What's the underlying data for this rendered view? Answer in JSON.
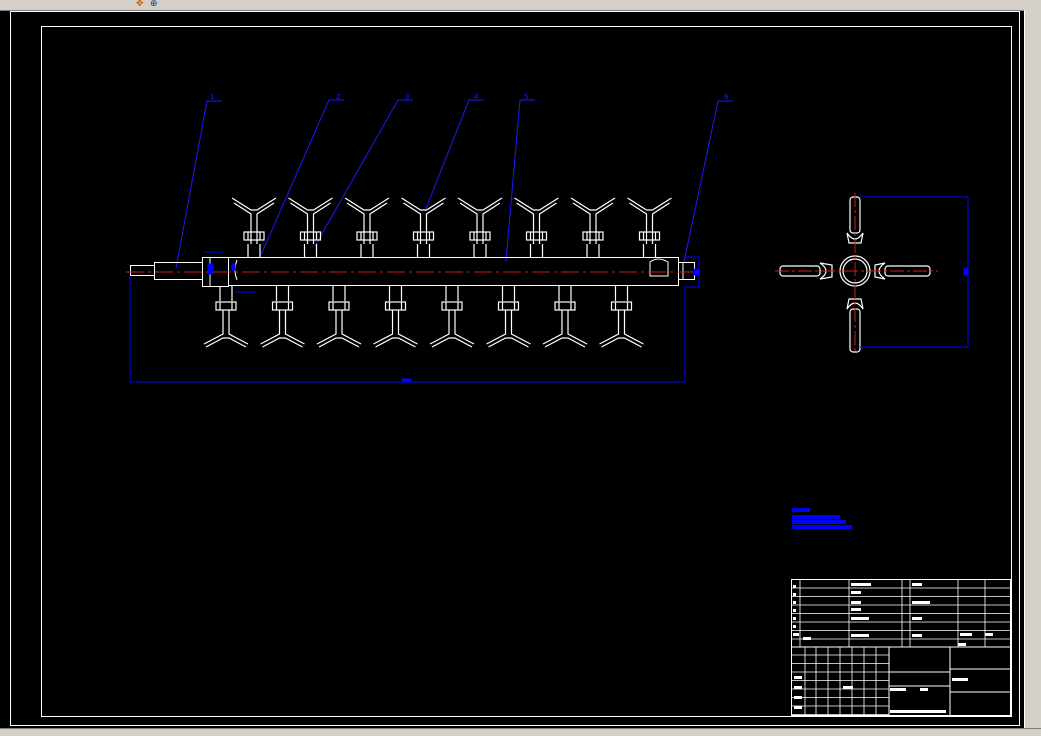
{
  "window": {
    "toolbar_icons": [
      "pan-icon",
      "zoom-icon"
    ]
  },
  "colors": {
    "background": "#000000",
    "geometry": "#ffffff",
    "dimension": "#0000ff",
    "centerline": "#c81e1e",
    "leader": "#1a1aff"
  },
  "drawing": {
    "balloons": [
      "1",
      "2",
      "3",
      "4",
      "5",
      "6"
    ],
    "front_view": {
      "upper_arms": 8,
      "lower_arms": 8
    },
    "side_view": {
      "arms": 4
    },
    "title_block": {
      "present": true
    }
  }
}
